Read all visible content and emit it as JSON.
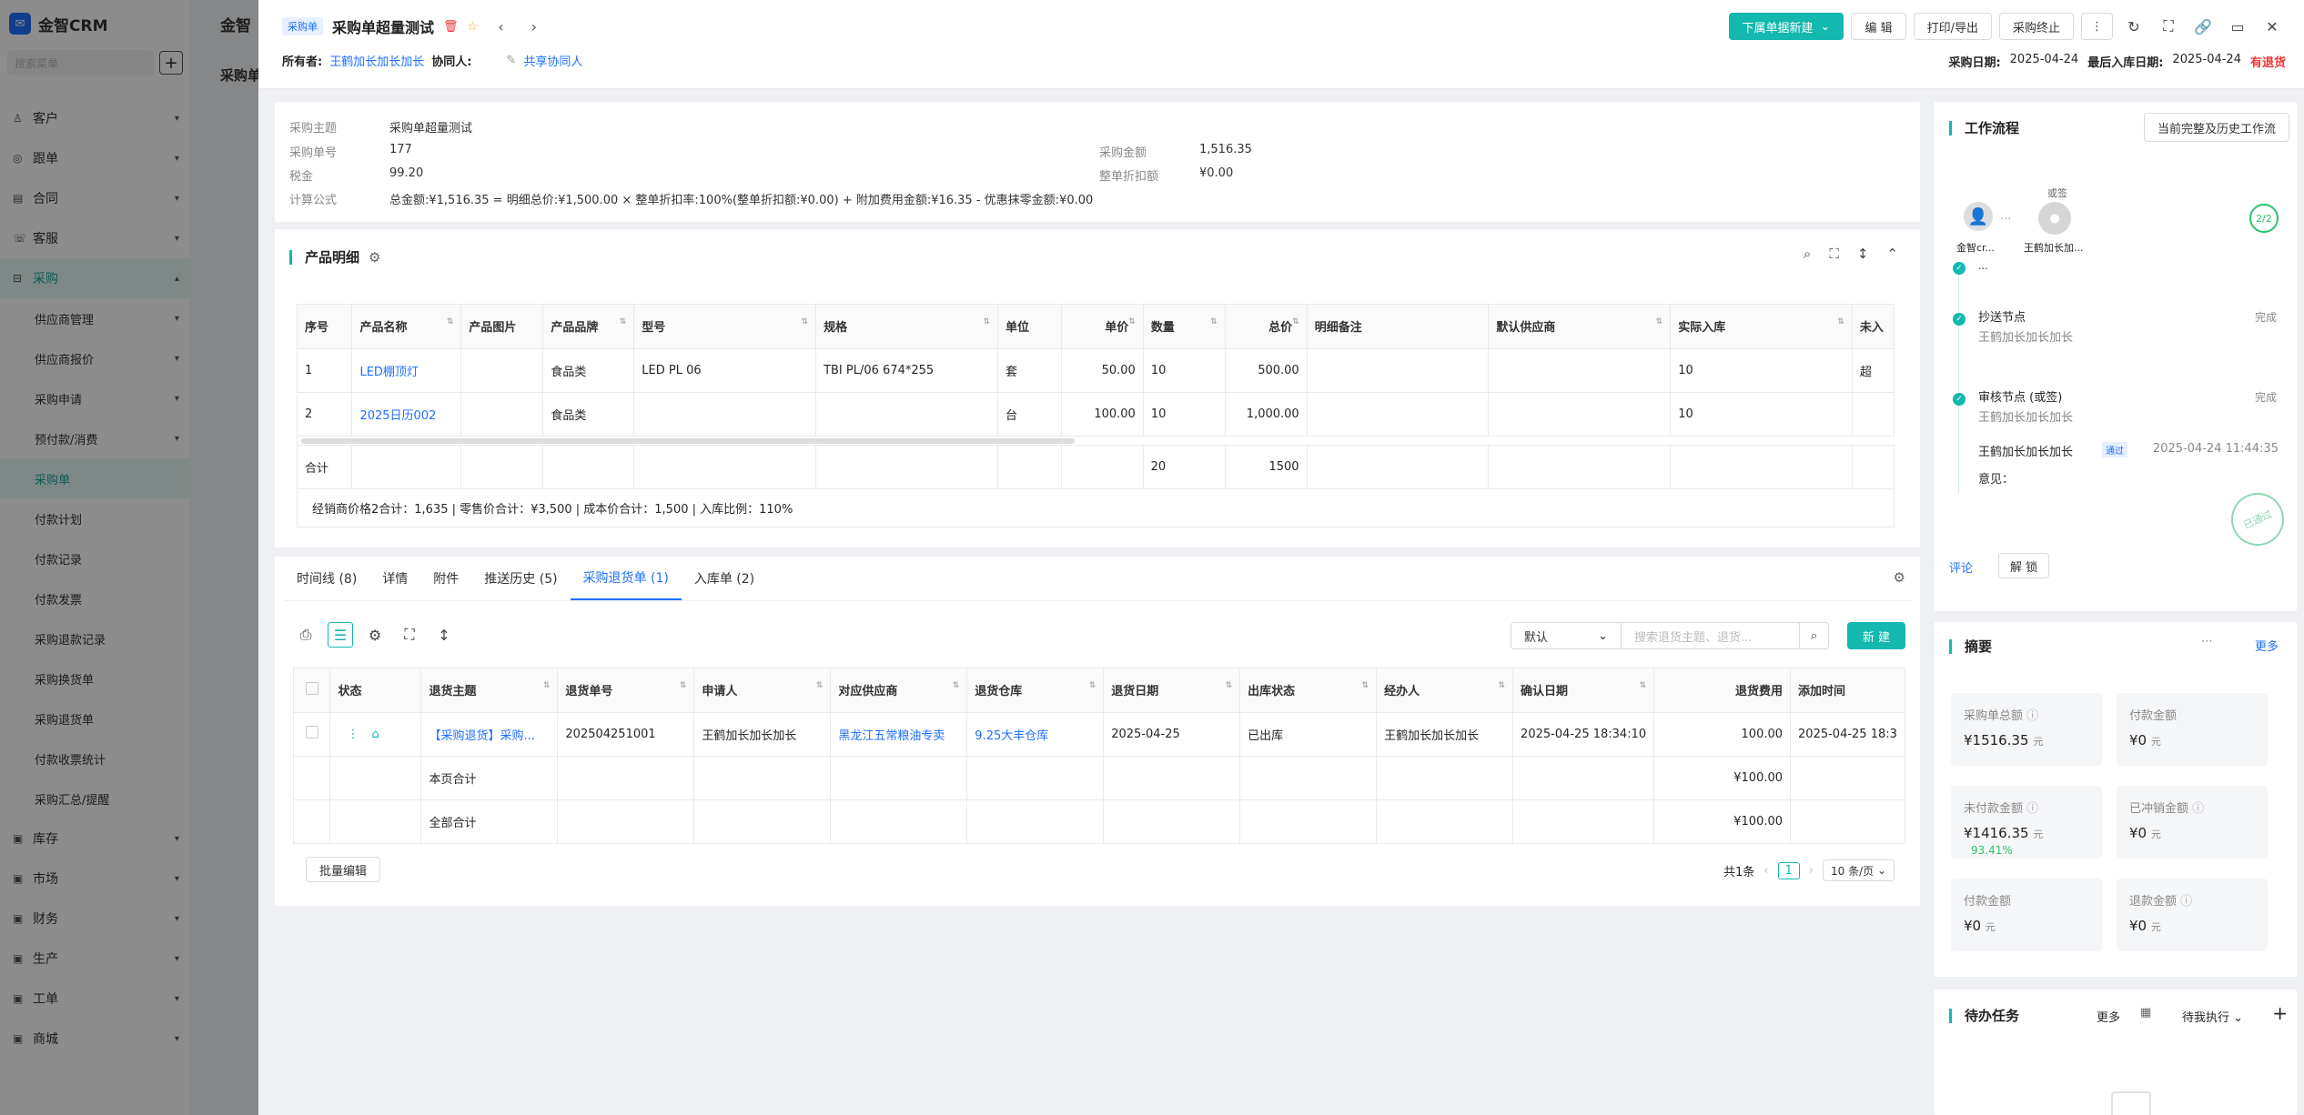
{
  "sidebar": {
    "logo": "金智CRM",
    "search_placeholder": "搜索菜单",
    "items": [
      {
        "label": "客户"
      },
      {
        "label": "跟单"
      },
      {
        "label": "合同"
      },
      {
        "label": "客服"
      },
      {
        "label": "采购"
      }
    ],
    "sub_items": [
      {
        "label": "供应商管理"
      },
      {
        "label": "供应商报价"
      },
      {
        "label": "采购申请"
      },
      {
        "label": "预付款/消费"
      },
      {
        "label": "采购单"
      },
      {
        "label": "付款计划"
      },
      {
        "label": "付款记录"
      },
      {
        "label": "付款发票"
      },
      {
        "label": "采购退款记录"
      },
      {
        "label": "采购换货单"
      },
      {
        "label": "采购退货单"
      },
      {
        "label": "付款收票统计"
      },
      {
        "label": "采购汇总/提醒"
      }
    ],
    "bottom_items": [
      {
        "label": "库存"
      },
      {
        "label": "市场"
      },
      {
        "label": "财务"
      },
      {
        "label": "生产"
      },
      {
        "label": "工单"
      },
      {
        "label": "商城"
      }
    ]
  },
  "bg": {
    "title1": "金智",
    "title2": "采购单"
  },
  "header": {
    "tag": "采购单",
    "title": "采购单超量测试",
    "owner_label": "所有者:",
    "owner": "王鹤加长加长加长",
    "collab_label": "协同人:",
    "share": "共享协同人",
    "btn_push": "下属单据新建",
    "btn_edit": "编 辑",
    "btn_print": "打印/导出",
    "btn_stop": "采购终止",
    "date_label": "采购日期:",
    "date": "2025-04-24",
    "last_in_label": "最后入库日期:",
    "last_in": "2025-04-24",
    "status": "有退货"
  },
  "info": {
    "subject_k": "采购主题",
    "subject_v": "采购单超量测试",
    "no_k": "采购单号",
    "no_v": "177",
    "amount_k": "采购金额",
    "amount_v": "1,516.35",
    "tax_k": "税金",
    "tax_v": "99.20",
    "discount_k": "整单折扣额",
    "discount_v": "¥0.00",
    "formula_k": "计算公式",
    "formula_v": "总金额:¥1,516.35 = 明细总价:¥1,500.00 × 整单折扣率:100%(整单折扣额:¥0.00) + 附加费用金额:¥16.35 - 优惠抹零金额:¥0.00"
  },
  "products": {
    "title": "产品明细",
    "headers": [
      "序号",
      "产品名称",
      "产品图片",
      "产品品牌",
      "型号",
      "规格",
      "单位",
      "单价",
      "数量",
      "总价",
      "明细备注",
      "默认供应商",
      "实际入库",
      "未入"
    ],
    "rows": [
      [
        "1",
        "LED棚顶灯",
        "",
        "食品类",
        "LED PL 06",
        "TBI PL/06 674*255",
        "套",
        "50.00",
        "10",
        "500.00",
        "",
        "",
        "10",
        "超"
      ],
      [
        "2",
        "2025日历002",
        "",
        "食品类",
        "",
        "",
        "台",
        "100.00",
        "10",
        "1,000.00",
        "",
        "",
        "10",
        ""
      ]
    ],
    "total_label": "合计",
    "total_qty": "20",
    "total_amount": "1500",
    "summary": "经销商价格2合计：1,635 | 零售价合计：¥3,500 | 成本价合计：1,500 | 入库比例：110%"
  },
  "tabs": [
    {
      "label": "时间线 (8)"
    },
    {
      "label": "详情"
    },
    {
      "label": "附件"
    },
    {
      "label": "推送历史 (5)"
    },
    {
      "label": "采购退货单 (1)"
    },
    {
      "label": "入库单 (2)"
    }
  ],
  "returns": {
    "default_view": "默认",
    "search_placeholder": "搜索退货主题、退货...",
    "new_btn": "新 建",
    "headers": [
      "状态",
      "退货主题",
      "退货单号",
      "申请人",
      "对应供应商",
      "退货仓库",
      "退货日期",
      "出库状态",
      "经办人",
      "确认日期",
      "退货费用",
      "添加时间"
    ],
    "row": {
      "subject": "【采购退货】采购...",
      "no": "202504251001",
      "applicant": "王鹤加长加长加长",
      "supplier": "黑龙江五常粮油专卖",
      "warehouse": "9.25大丰仓库",
      "date": "2025-04-25",
      "out_status": "已出库",
      "handler": "王鹤加长加长加长",
      "confirm": "2025-04-25 18:34:10",
      "fee": "100.00",
      "added": "2025-04-25 18:3"
    },
    "page_total_label": "本页合计",
    "page_total": "¥100.00",
    "all_total_label": "全部合计",
    "all_total": "¥100.00",
    "batch_edit": "批量编辑",
    "count": "共1条",
    "page": "1",
    "page_size": "10 条/页"
  },
  "workflow": {
    "title": "工作流程",
    "history_btn": "当前完整及历史工作流",
    "or_sign": "或签",
    "avatar1_name": "金智cr...",
    "avatar2_name": "王鹤加长加...",
    "progress": "2/2",
    "dots": "...",
    "node1_title": "抄送节点",
    "node1_user": "王鹤加长加长加长",
    "node1_status": "完成",
    "node2_title": "审核节点 (或签)",
    "node2_user": "王鹤加长加长加长",
    "node2_status": "完成",
    "approver": "王鹤加长加长加长",
    "approve_tag": "通过",
    "approve_time": "2025-04-24 11:44:35",
    "opinion": "意见：",
    "stamp": "已通过",
    "comment": "评论",
    "unlock": "解 锁"
  },
  "summary": {
    "title": "摘要",
    "more": "更多",
    "boxes": [
      {
        "k": "采购单总额",
        "v": "¥1516.35",
        "u": "元"
      },
      {
        "k": "付款金额",
        "v": "¥0",
        "u": "元"
      },
      {
        "k": "未付款金额",
        "v": "¥1416.35",
        "u": "元",
        "pct": "93.41%"
      },
      {
        "k": "已冲销金额",
        "v": "¥0",
        "u": "元"
      },
      {
        "k": "付款金额",
        "v": "¥0",
        "u": "元"
      },
      {
        "k": "退款金额",
        "v": "¥0",
        "u": "元"
      }
    ]
  },
  "todo": {
    "title": "待办任务",
    "more": "更多",
    "filter": "待我执行"
  }
}
